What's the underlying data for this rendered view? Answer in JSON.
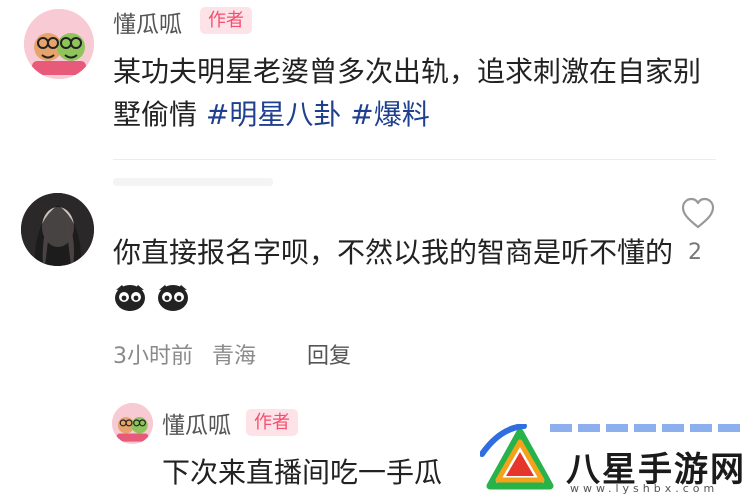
{
  "post": {
    "author": "懂瓜呱",
    "badge": "作者",
    "text": "某功夫明星老婆曾多次出轨，追求刺激在自家别墅偷情",
    "hashtags": [
      "#明星八卦",
      "#爆料"
    ]
  },
  "comment": {
    "text": "你直接报名字呗，不然以我的智商是听不懂的",
    "emoji_icons": [
      "dark-face-emoji-icon",
      "dark-face-emoji-icon"
    ],
    "like_count": "2",
    "time": "3小时前",
    "location": "青海",
    "reply_label": "回复"
  },
  "reply": {
    "author": "懂瓜呱",
    "badge": "作者",
    "text": "下次来直播间吃一手瓜"
  },
  "watermark": {
    "brand": "八星手游网",
    "url": "www.lyshbx.com"
  },
  "colors": {
    "badge_text": "#f34f6f",
    "badge_bg": "#fde3e8",
    "hashtag": "#1f3f8f",
    "meta": "#8a8a8a"
  }
}
